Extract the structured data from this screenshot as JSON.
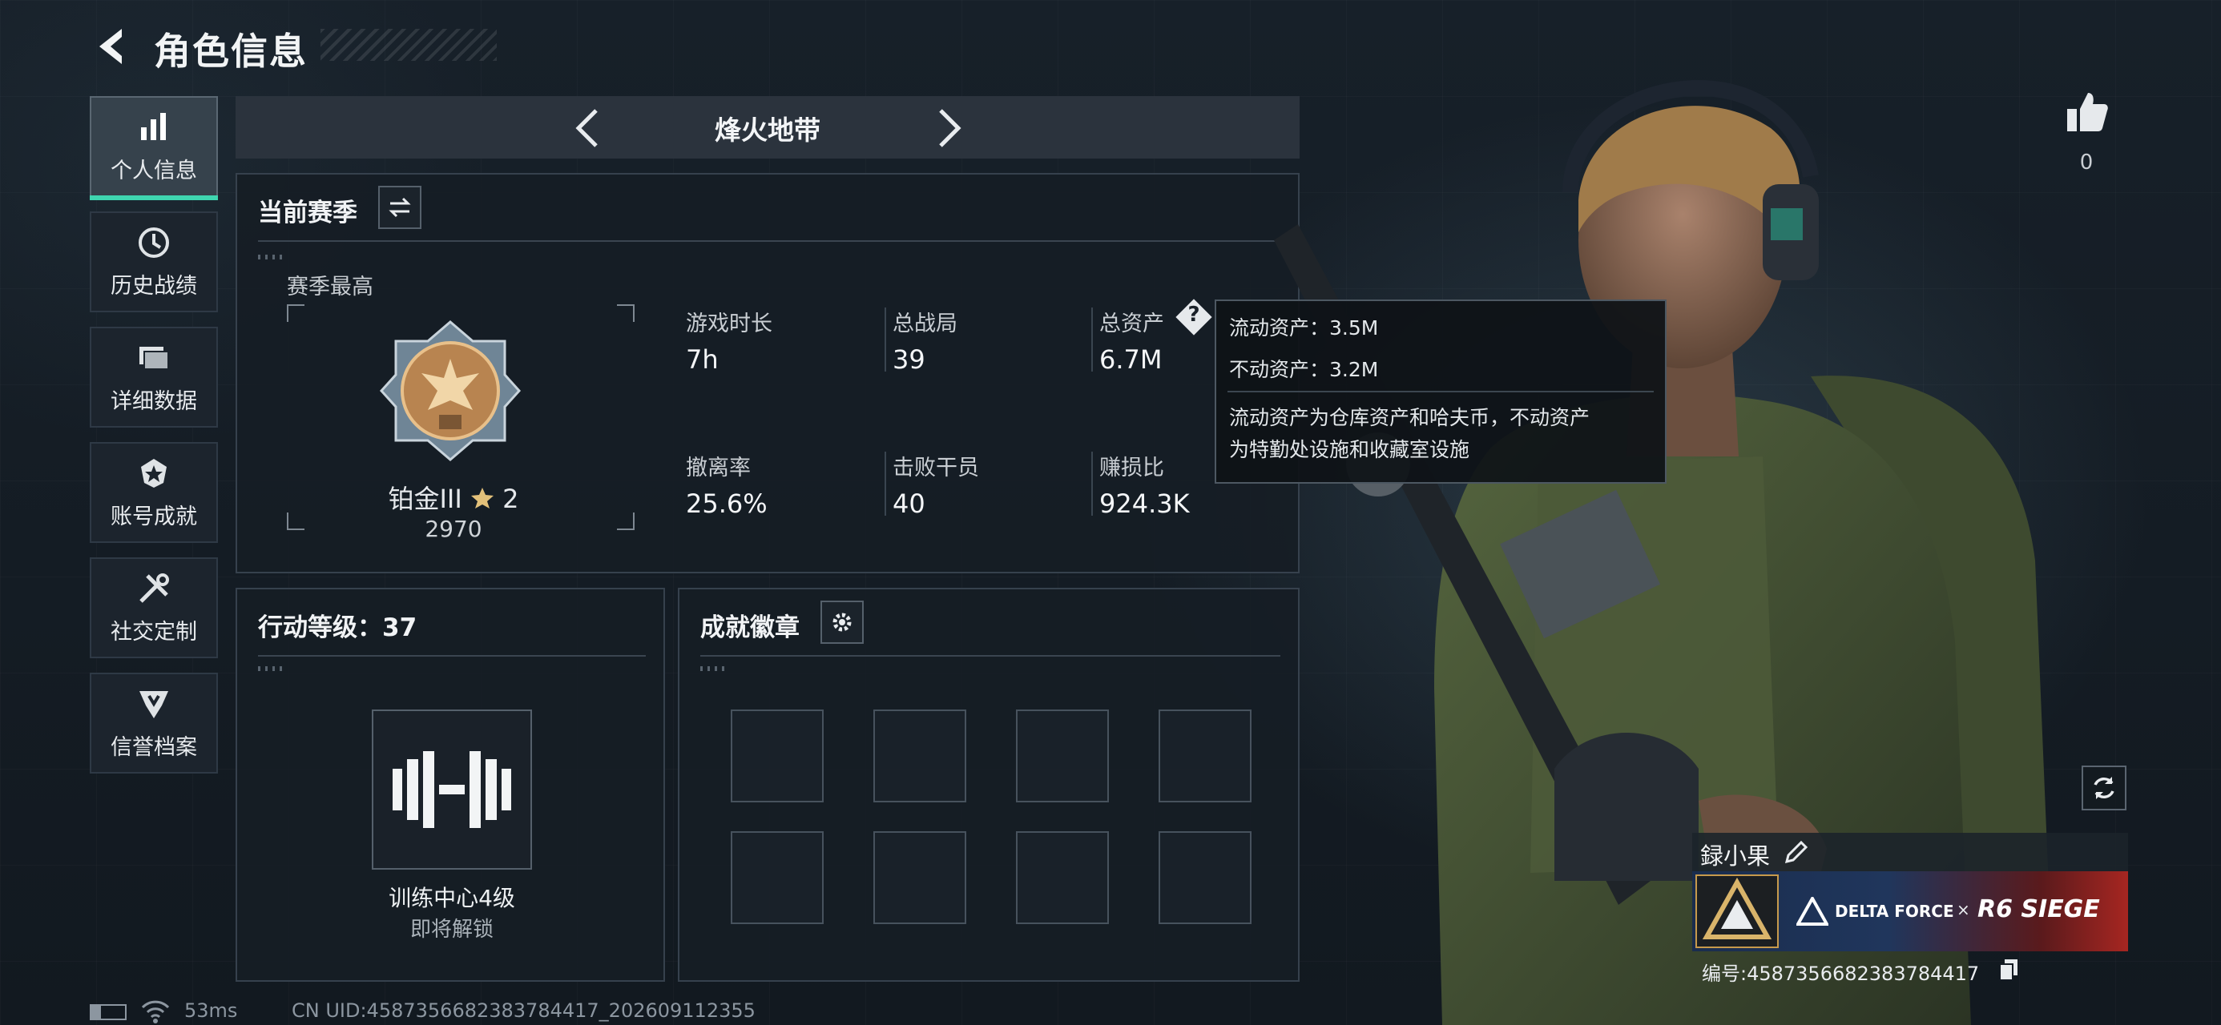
{
  "header": {
    "title": "角色信息"
  },
  "sidebar": {
    "items": [
      {
        "label": "个人信息",
        "icon": "bar-chart-icon",
        "active": true
      },
      {
        "label": "历史战绩",
        "icon": "clock-icon"
      },
      {
        "label": "详细数据",
        "icon": "folders-icon"
      },
      {
        "label": "账号成就",
        "icon": "medal-icon"
      },
      {
        "label": "社交定制",
        "icon": "tools-icon"
      },
      {
        "label": "信誉档案",
        "icon": "credit-shield-icon"
      }
    ]
  },
  "map_selector": {
    "name": "烽火地带"
  },
  "season": {
    "title": "当前赛季",
    "best_label": "赛季最高",
    "rank_name": "铂金III",
    "rank_stars": "2",
    "rank_score": "2970",
    "stats": [
      {
        "label": "游戏时长",
        "value": "7h"
      },
      {
        "label": "总战局",
        "value": "39"
      },
      {
        "label": "总资产",
        "value": "6.7M"
      },
      {
        "label": "撤离率",
        "value": "25.6%"
      },
      {
        "label": "击败干员",
        "value": "40"
      },
      {
        "label": "赚损比",
        "value": "924.3K"
      }
    ]
  },
  "tooltip": {
    "liquid": "流动资产：3.5M",
    "fixed": "不动资产：3.2M",
    "note_line1": "流动资产为仓库资产和哈夫币，不动资产",
    "note_line2": "为特勤处设施和收藏室设施"
  },
  "action_level": {
    "title": "行动等级：37",
    "item_name": "训练中心4级",
    "item_status": "即将解锁"
  },
  "achievements": {
    "title": "成就徽章"
  },
  "likes": {
    "count": "0"
  },
  "player": {
    "name": "録小果",
    "banner_brand": "DELTA FORCE",
    "banner_sep": "×",
    "banner_collab": "R6 SIEGE",
    "id_text": "编号:4587356682383784417"
  },
  "status_bar": {
    "ping": "53ms",
    "uid": "CN UID:4587356682383784417_202609112355"
  },
  "colors": {
    "accent": "#3fd6b0",
    "panel_border": "#36414d",
    "background": "#131a22"
  }
}
